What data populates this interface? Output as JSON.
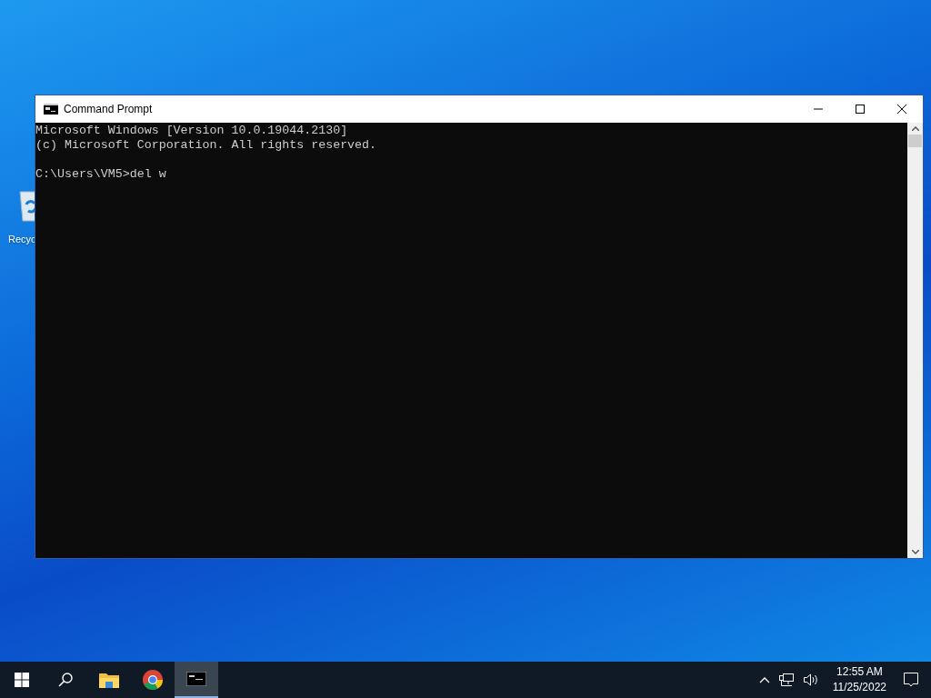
{
  "desktop": {
    "icons": [
      {
        "label": "Recyc",
        "kind": "recycle-bin"
      }
    ]
  },
  "window": {
    "title": "Command Prompt",
    "console_blocks": [
      [
        "Microsoft Windows [Version 10.0.19044.2130]",
        "(c) Microsoft Corporation. All rights reserved."
      ],
      [
        "C:\\Users\\VM5>del w"
      ]
    ]
  },
  "taskbar": {
    "items": [
      {
        "kind": "start",
        "selected": false
      },
      {
        "kind": "search",
        "selected": false
      },
      {
        "kind": "explorer",
        "selected": false
      },
      {
        "kind": "chrome",
        "selected": false
      },
      {
        "kind": "console",
        "selected": true
      }
    ],
    "tray": {
      "time": "12:55 AM",
      "date": "11/25/2022"
    }
  }
}
